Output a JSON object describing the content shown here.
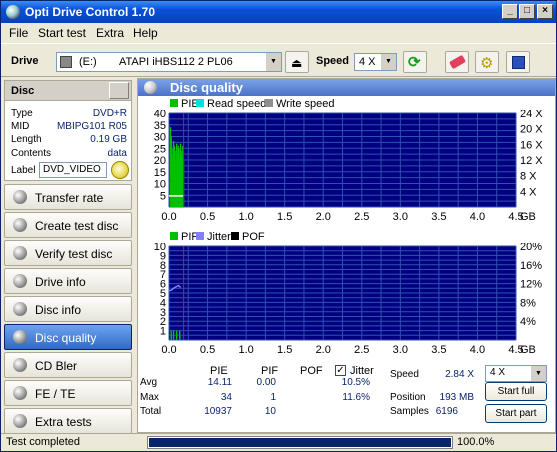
{
  "window": {
    "title": "Opti Drive Control 1.70",
    "minimize": "_",
    "maximize": "□",
    "close": "×"
  },
  "menu": [
    "File",
    "Start test",
    "Extra",
    "Help"
  ],
  "toolbar": {
    "drive_label": "Drive",
    "drive_letter": "(E:)",
    "drive_model": "ATAPI iHBS112 2 PL06",
    "speed_label": "Speed",
    "speed_value": "4 X"
  },
  "disc": {
    "header": "Disc",
    "type_label": "Type",
    "type_value": "DVD+R",
    "mid_label": "MID",
    "mid_value": "MBIPG101 R05",
    "length_label": "Length",
    "length_value": "0.19 GB",
    "contents_label": "Contents",
    "contents_value": "data",
    "label_label": "Label",
    "label_value": "DVD_VIDEO"
  },
  "nav": [
    "Transfer rate",
    "Create test disc",
    "Verify test disc",
    "Drive info",
    "Disc info",
    "Disc quality",
    "CD Bler",
    "FE / TE",
    "Extra tests"
  ],
  "nav_active": 5,
  "main": {
    "title": "Disc quality"
  },
  "chart_data": [
    {
      "type": "bar",
      "legend": [
        "PIE",
        "Read speed",
        "Write speed"
      ],
      "legend_colors": [
        "#00c000",
        "#00e0e0",
        "#909090"
      ],
      "xlim": [
        0,
        4.5
      ],
      "xunit": "GB",
      "x_ticks": [
        "0.0",
        "0.5",
        "1.0",
        "1.5",
        "2.0",
        "2.5",
        "3.0",
        "3.5",
        "4.0",
        "4.5"
      ],
      "ylim": [
        0,
        40
      ],
      "y_ticks": [
        "5",
        "10",
        "15",
        "20",
        "25",
        "30",
        "35",
        "40"
      ],
      "y2_ticks": [
        "4 X",
        "8 X",
        "12 X",
        "16 X",
        "20 X",
        "24 X"
      ],
      "series": [
        {
          "name": "PIE",
          "x": [
            0.01,
            0.02,
            0.03,
            0.04,
            0.05,
            0.06,
            0.07,
            0.08,
            0.09,
            0.1,
            0.11,
            0.12,
            0.13,
            0.14,
            0.15,
            0.16,
            0.17,
            0.18
          ],
          "values": [
            34,
            30,
            25,
            22,
            28,
            26,
            24,
            20,
            27,
            23,
            26,
            25,
            22,
            27,
            24,
            21,
            26,
            20
          ]
        },
        {
          "name": "Read speed",
          "x": [
            0.0,
            0.19
          ],
          "values": [
            2.84,
            2.84
          ]
        }
      ],
      "marker_x": 0.19
    },
    {
      "type": "bar",
      "legend": [
        "PIF",
        "Jitter",
        "POF"
      ],
      "legend_colors": [
        "#00c000",
        "#8080ff",
        "#000000"
      ],
      "xlim": [
        0,
        4.5
      ],
      "xunit": "GB",
      "x_ticks": [
        "0.0",
        "0.5",
        "1.0",
        "1.5",
        "2.0",
        "2.5",
        "3.0",
        "3.5",
        "4.0",
        "4.5"
      ],
      "ylim": [
        0,
        10
      ],
      "y_ticks": [
        "1",
        "2",
        "3",
        "4",
        "5",
        "6",
        "7",
        "8",
        "9",
        "10"
      ],
      "y2_ticks": [
        "4%",
        "8%",
        "12%",
        "16%",
        "20%"
      ],
      "series": [
        {
          "name": "PIF",
          "x": [
            0.02,
            0.05,
            0.09,
            0.13
          ],
          "values": [
            1,
            1,
            1,
            1
          ]
        },
        {
          "name": "Jitter",
          "x": [
            0.0,
            0.03,
            0.06,
            0.09,
            0.12,
            0.15
          ],
          "values": [
            10.5,
            10.6,
            11.0,
            11.3,
            11.6,
            11.2
          ]
        }
      ],
      "marker_x": 0.19
    }
  ],
  "stats": {
    "headers": [
      "PIE",
      "PIF",
      "POF"
    ],
    "jitter_label": "Jitter",
    "rows": [
      {
        "label": "Avg",
        "pie": "14.11",
        "pif": "0.00",
        "jitter": "10.5%"
      },
      {
        "label": "Max",
        "pie": "34",
        "pif": "1",
        "jitter": "11.6%"
      },
      {
        "label": "Total",
        "pie": "10937",
        "pif": "10"
      }
    ],
    "speed_label": "Speed",
    "speed_value": "2.84 X",
    "position_label": "Position",
    "position_value": "193 MB",
    "samples_label": "Samples",
    "samples_value": "6196",
    "speed_select": "4 X",
    "start_full": "Start full",
    "start_part": "Start part"
  },
  "status": {
    "text": "Test completed",
    "progress": 1.0,
    "progress_text": "100.0%"
  },
  "colors": {
    "plot_bg": "#000080",
    "grid": "#3050b0",
    "marker": "#c02020",
    "pie": "#00c000",
    "read": "#ffffff",
    "jitter": "#8080ff"
  }
}
